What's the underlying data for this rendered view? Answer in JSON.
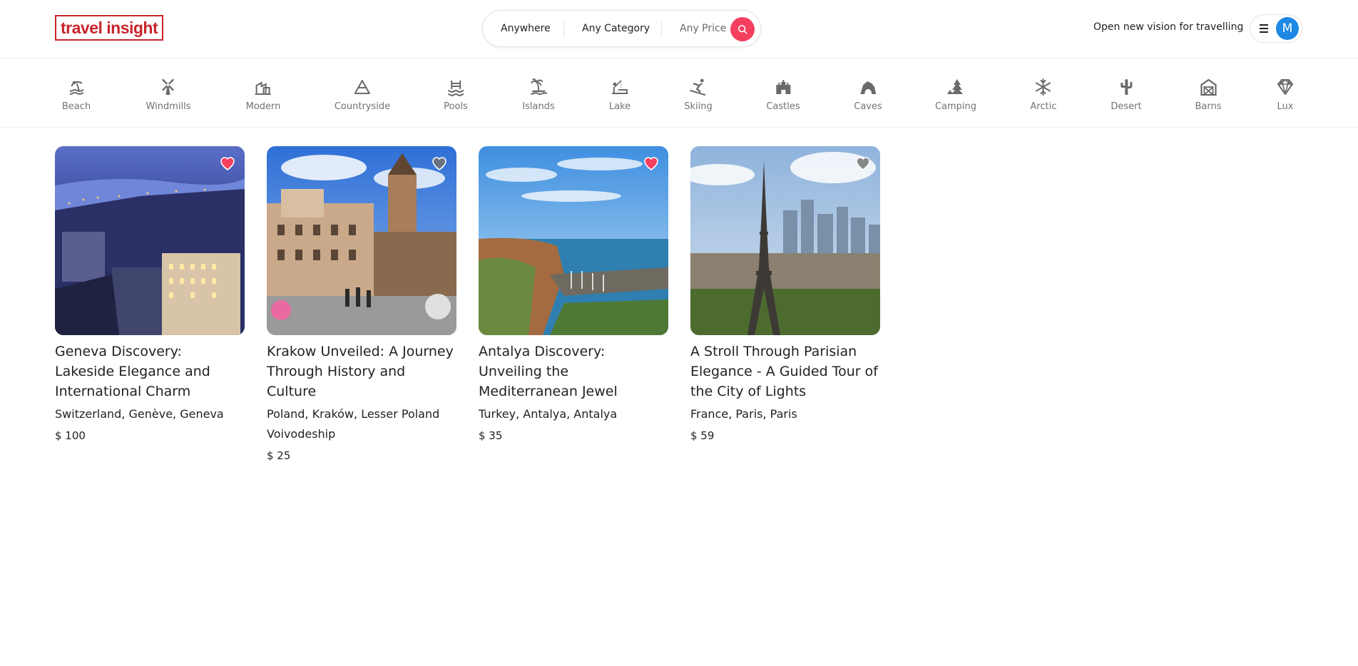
{
  "header": {
    "logo_text": "travel insight",
    "tagline": "Open new vision for travelling",
    "user_initial": "M"
  },
  "search": {
    "location": "Anywhere",
    "category": "Any Category",
    "price": "Any Price"
  },
  "categories": [
    {
      "label": "Beach",
      "icon": "beach-icon"
    },
    {
      "label": "Windmills",
      "icon": "windmill-icon"
    },
    {
      "label": "Modern",
      "icon": "modern-house-icon"
    },
    {
      "label": "Countryside",
      "icon": "mountain-icon"
    },
    {
      "label": "Pools",
      "icon": "pool-icon"
    },
    {
      "label": "Islands",
      "icon": "island-icon"
    },
    {
      "label": "Lake",
      "icon": "lake-icon"
    },
    {
      "label": "Skiing",
      "icon": "skiing-icon"
    },
    {
      "label": "Castles",
      "icon": "castle-icon"
    },
    {
      "label": "Caves",
      "icon": "cave-icon"
    },
    {
      "label": "Camping",
      "icon": "camping-icon"
    },
    {
      "label": "Arctic",
      "icon": "snowflake-icon"
    },
    {
      "label": "Desert",
      "icon": "cactus-icon"
    },
    {
      "label": "Barns",
      "icon": "barn-icon"
    },
    {
      "label": "Lux",
      "icon": "diamond-icon"
    }
  ],
  "listings": [
    {
      "title": "Geneva Discovery: Lakeside Elegance and International Charm",
      "location": "Switzerland, Genève, Geneva",
      "price": "$ 100",
      "favorited": true
    },
    {
      "title": "Krakow Unveiled: A Journey Through History and Culture",
      "location": "Poland, Kraków, Lesser Poland Voivodeship",
      "price": "$ 25",
      "favorited": false
    },
    {
      "title": "Antalya Discovery: Unveiling the Mediterranean Jewel",
      "location": "Turkey, Antalya, Antalya",
      "price": "$ 35",
      "favorited": true
    },
    {
      "title": "A Stroll Through Parisian Elegance - A Guided Tour of the City of Lights",
      "location": "France, Paris, Paris",
      "price": "$ 59",
      "favorited": false
    }
  ],
  "colors": {
    "brand": "#c8242b",
    "accent": "#f43f5e",
    "avatar": "#1e88e5",
    "heart_on": "#f43f5e",
    "heart_off": "#737373"
  }
}
